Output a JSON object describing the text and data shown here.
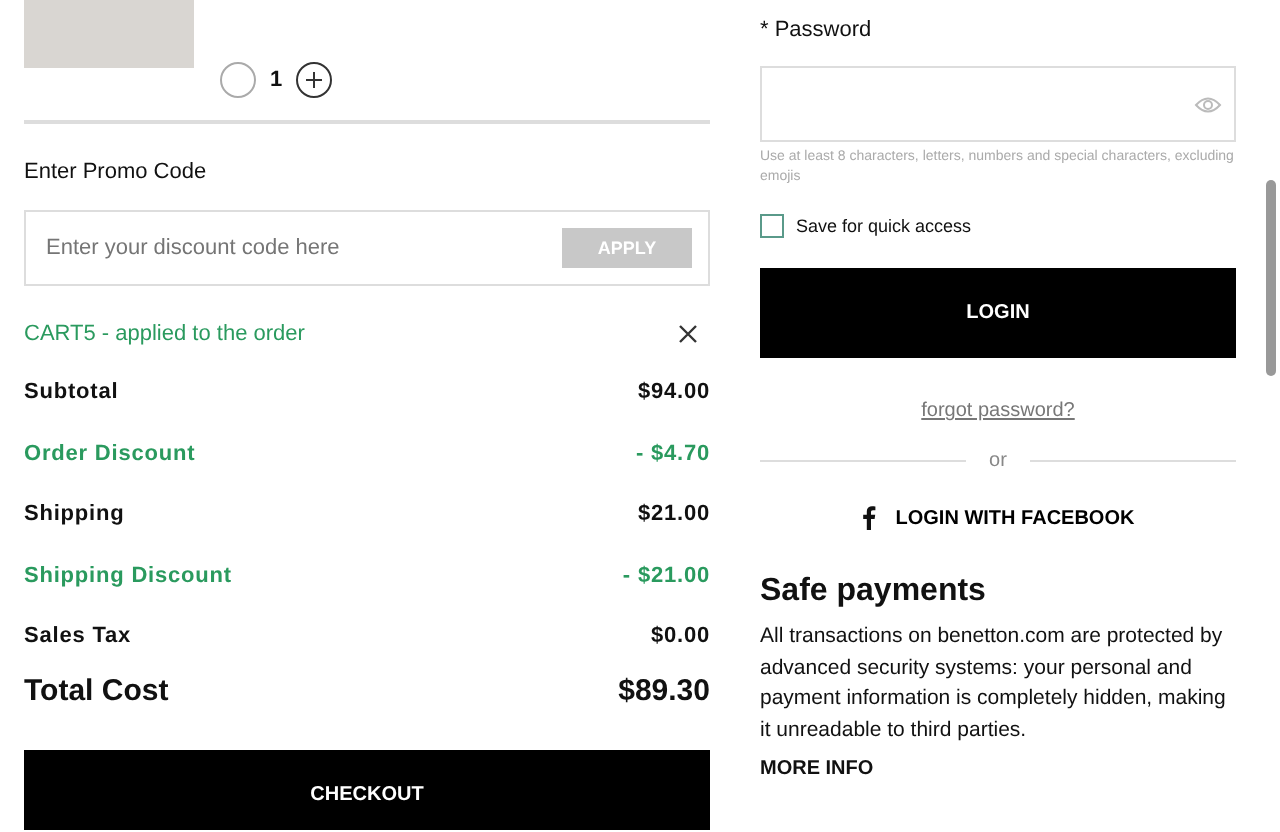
{
  "cart": {
    "quantity": "1",
    "decrement_disabled": true
  },
  "promo": {
    "title": "Enter Promo Code",
    "placeholder": "Enter your discount code here",
    "apply_button": "APPLY",
    "apply_disabled": true,
    "applied": "CART5 - applied to the order"
  },
  "summary": [
    {
      "label": "Subtotal",
      "value": "$94.00",
      "kind": "normal"
    },
    {
      "label": "Order Discount",
      "value": "- $4.70",
      "kind": "discount"
    },
    {
      "label": "Shipping",
      "value": "$21.00",
      "kind": "normal"
    },
    {
      "label": "Shipping Discount",
      "value": "- $21.00",
      "kind": "discount"
    },
    {
      "label": "Sales Tax",
      "value": "$0.00",
      "kind": "normal"
    }
  ],
  "total": {
    "label": "Total Cost",
    "value": "$89.30"
  },
  "checkout_button": "CHECKOUT",
  "login": {
    "password_label": "* Password",
    "password_hint": "Use at least 8 characters, letters, numbers and special characters, excluding emojis",
    "save_label": "Save for quick access",
    "save_checked": false,
    "login_button": "LOGIN",
    "forgot_link": "forgot password?",
    "or": "or",
    "facebook_button": "LOGIN WITH FACEBOOK"
  },
  "safe_payments": {
    "title": "Safe payments",
    "text": "All transactions on benetton.com are protected by advanced security systems: your personal and payment information is completely hidden, making it unreadable to third parties.",
    "link": "MORE INFO"
  }
}
